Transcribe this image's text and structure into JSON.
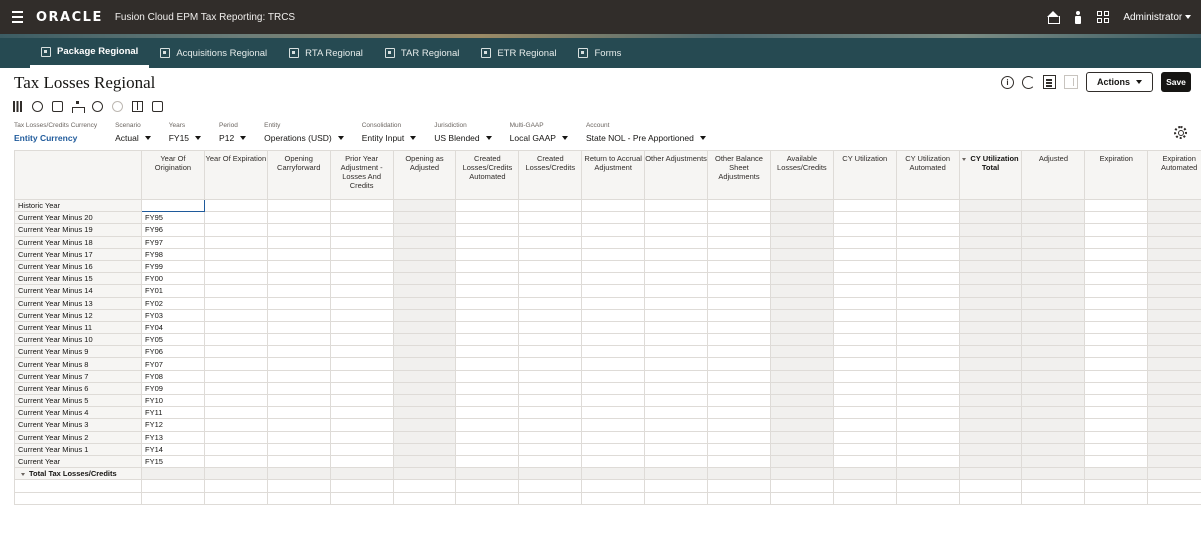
{
  "topbar": {
    "logo": "ORACLE",
    "app_title": "Fusion Cloud EPM Tax Reporting: TRCS",
    "user": "Administrator"
  },
  "nav": {
    "tabs": [
      {
        "label": "Package Regional",
        "active": true
      },
      {
        "label": "Acquisitions Regional"
      },
      {
        "label": "RTA Regional"
      },
      {
        "label": "TAR Regional"
      },
      {
        "label": "ETR Regional"
      },
      {
        "label": "Forms"
      }
    ]
  },
  "page": {
    "title": "Tax Losses Regional",
    "actions_label": "Actions",
    "save_label": "Save"
  },
  "pov": [
    {
      "label": "Tax Losses/Credits Currency",
      "value": "Entity Currency",
      "link": true,
      "dropdown": false
    },
    {
      "label": "Scenario",
      "value": "Actual",
      "dropdown": true
    },
    {
      "label": "Years",
      "value": "FY15",
      "dropdown": true
    },
    {
      "label": "Period",
      "value": "P12",
      "dropdown": true
    },
    {
      "label": "Entity",
      "value": "Operations (USD)",
      "dropdown": true
    },
    {
      "label": "Consolidation",
      "value": "Entity Input",
      "dropdown": true
    },
    {
      "label": "Jurisdiction",
      "value": "US Blended",
      "dropdown": true
    },
    {
      "label": "Multi-GAAP",
      "value": "Local GAAP",
      "dropdown": true
    },
    {
      "label": "Account",
      "value": "State NOL - Pre Apportioned",
      "dropdown": true
    }
  ],
  "grid": {
    "columns": [
      {
        "label": "Year Of Origination"
      },
      {
        "label": "Year Of Expiration"
      },
      {
        "label": "Opening Carryforward"
      },
      {
        "label": "Prior Year Adjustment - Losses And Credits"
      },
      {
        "label": "Opening as Adjusted"
      },
      {
        "label": "Created Losses/Credits Automated"
      },
      {
        "label": "Created Losses/Credits"
      },
      {
        "label": "Return to Accrual Adjustment"
      },
      {
        "label": "Other Adjustments"
      },
      {
        "label": "Other Balance Sheet Adjustments"
      },
      {
        "label": "Available Losses/Credits"
      },
      {
        "label": "CY Utilization"
      },
      {
        "label": "CY Utilization Automated"
      },
      {
        "label": "CY Utilization Total",
        "bold": true
      },
      {
        "label": "Adjusted"
      },
      {
        "label": "Expiration"
      },
      {
        "label": "Expiration Automated"
      }
    ],
    "rows": [
      {
        "label": "Historic Year",
        "fy": ""
      },
      {
        "label": "Current Year Minus 20",
        "fy": "FY95"
      },
      {
        "label": "Current Year Minus 19",
        "fy": "FY96"
      },
      {
        "label": "Current Year Minus 18",
        "fy": "FY97"
      },
      {
        "label": "Current Year Minus 17",
        "fy": "FY98"
      },
      {
        "label": "Current Year Minus 16",
        "fy": "FY99"
      },
      {
        "label": "Current Year Minus 15",
        "fy": "FY00"
      },
      {
        "label": "Current Year Minus 14",
        "fy": "FY01"
      },
      {
        "label": "Current Year Minus 13",
        "fy": "FY02"
      },
      {
        "label": "Current Year Minus 12",
        "fy": "FY03"
      },
      {
        "label": "Current Year Minus 11",
        "fy": "FY04"
      },
      {
        "label": "Current Year Minus 10",
        "fy": "FY05"
      },
      {
        "label": "Current Year Minus 9",
        "fy": "FY06"
      },
      {
        "label": "Current Year Minus 8",
        "fy": "FY07"
      },
      {
        "label": "Current Year Minus 7",
        "fy": "FY08"
      },
      {
        "label": "Current Year Minus 6",
        "fy": "FY09"
      },
      {
        "label": "Current Year Minus 5",
        "fy": "FY10"
      },
      {
        "label": "Current Year Minus 4",
        "fy": "FY11"
      },
      {
        "label": "Current Year Minus 3",
        "fy": "FY12"
      },
      {
        "label": "Current Year Minus 2",
        "fy": "FY13"
      },
      {
        "label": "Current Year Minus 1",
        "fy": "FY14"
      },
      {
        "label": "Current Year",
        "fy": "FY15"
      }
    ],
    "total_label": "Total Tax Losses/Credits"
  }
}
